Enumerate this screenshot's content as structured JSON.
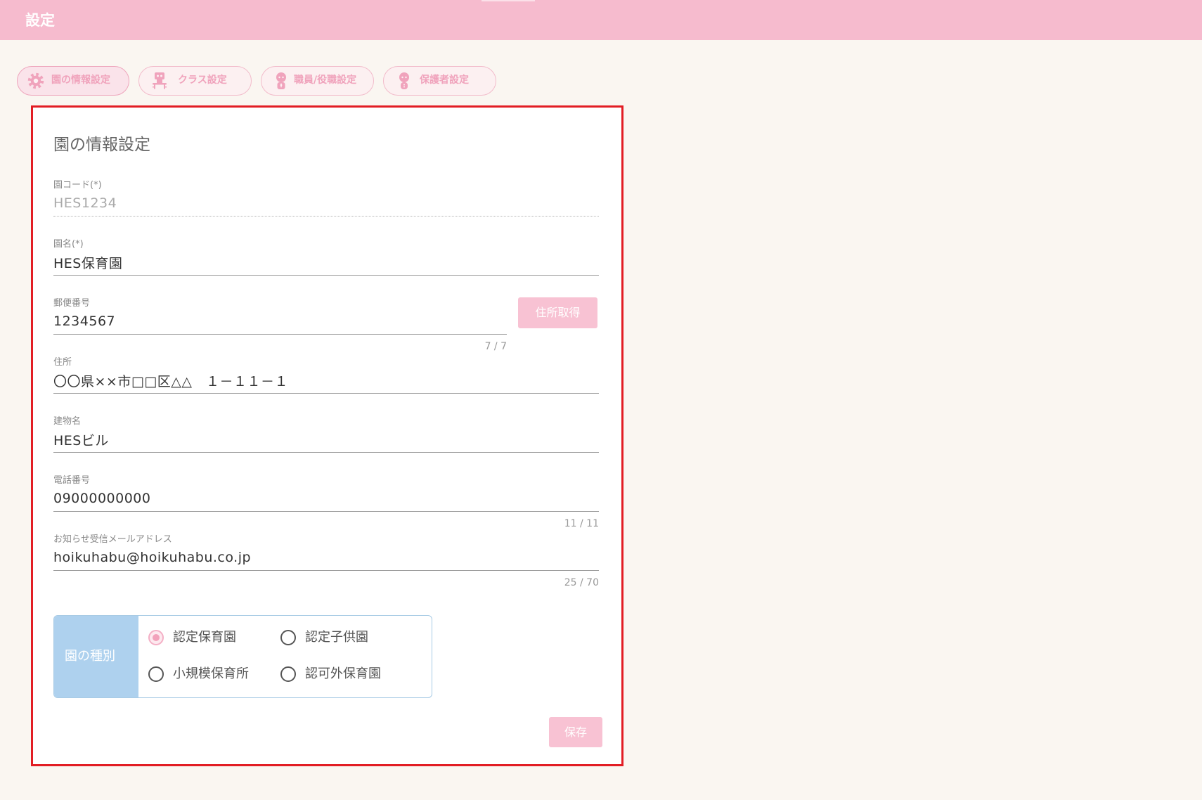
{
  "header": {
    "title": "設定"
  },
  "tabs": [
    {
      "label": "園の情報設定",
      "icon": "gear-icon",
      "active": true
    },
    {
      "label": "クラス設定",
      "icon": "classroom-icon",
      "active": false
    },
    {
      "label": "職員/役職設定",
      "icon": "staff-icon",
      "active": false
    },
    {
      "label": "保護者設定",
      "icon": "guardian-icon",
      "active": false
    }
  ],
  "form": {
    "title": "園の情報設定",
    "fields": {
      "code": {
        "label": "園コード(*)",
        "value": "HES1234",
        "disabled": true
      },
      "name": {
        "label": "園名(*)",
        "value": "HES保育園"
      },
      "postal": {
        "label": "郵便番号",
        "value": "1234567",
        "counter": "7 / 7"
      },
      "address": {
        "label": "住所",
        "value": "〇〇県××市□□区△△　１－１１－１"
      },
      "building": {
        "label": "建物名",
        "value": "HESビル"
      },
      "phone": {
        "label": "電話番号",
        "value": "09000000000",
        "counter": "11 / 11"
      },
      "email": {
        "label": "お知らせ受信メールアドレス",
        "value": "hoikuhabu@hoikuhabu.co.jp",
        "counter": "25 / 70"
      }
    },
    "address_lookup_button": "住所取得",
    "facility_type": {
      "label": "園の種別",
      "options": [
        {
          "label": "認定保育園",
          "checked": true
        },
        {
          "label": "認定子供園",
          "checked": false
        },
        {
          "label": "小規模保育所",
          "checked": false
        },
        {
          "label": "認可外保育園",
          "checked": false
        }
      ]
    },
    "save_button": "保存"
  },
  "colors": {
    "header": "#f6bbce",
    "accent": "#f8c2d3",
    "facility_label_bg": "#aed1ee",
    "highlight_border": "#e21d24",
    "background": "#faf6f1"
  }
}
